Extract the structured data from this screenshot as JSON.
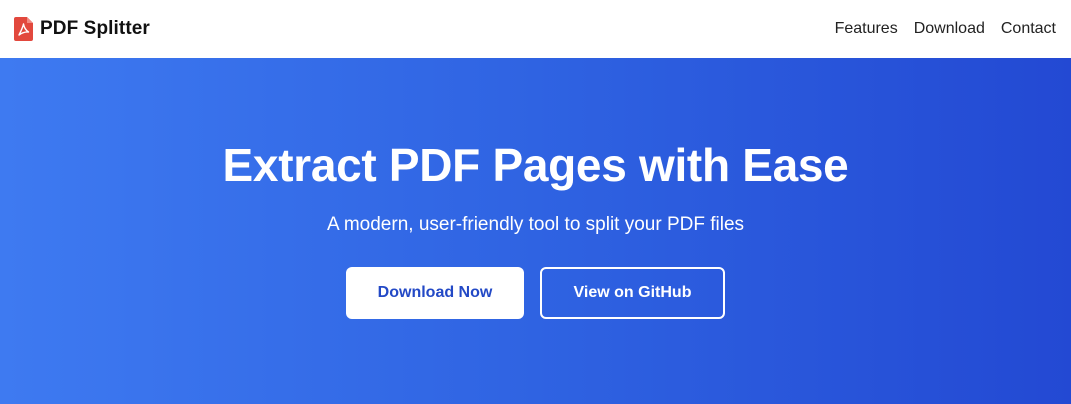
{
  "navbar": {
    "brand_name": "PDF Splitter",
    "brand_icon": "pdf-file-icon",
    "links": [
      "Features",
      "Download",
      "Contact"
    ]
  },
  "hero": {
    "title": "Extract PDF Pages with Ease",
    "subtitle": "A modern, user-friendly tool to split your PDF files",
    "primary_button": "Download Now",
    "secondary_button": "View on GitHub"
  },
  "colors": {
    "hero_gradient_start": "#3e7af1",
    "hero_gradient_end": "#2349d3",
    "primary_button_text": "#2349c6",
    "pdf_icon": "#e2483d"
  }
}
